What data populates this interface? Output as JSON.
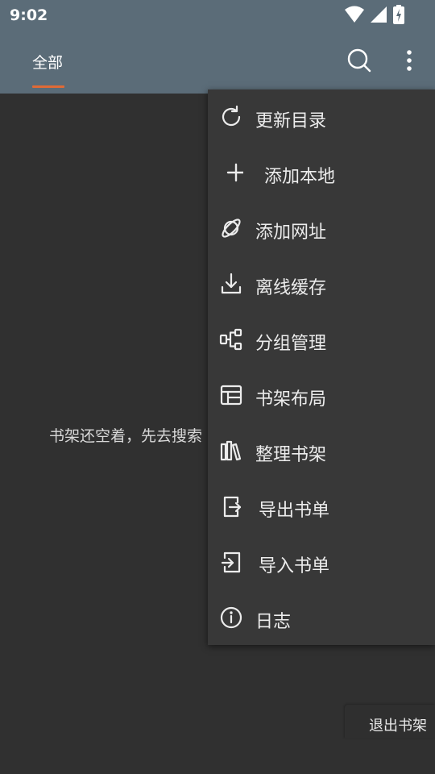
{
  "status_bar": {
    "time": "9:02",
    "icons": [
      "wifi-icon",
      "cell-signal-icon",
      "battery-charging-icon"
    ]
  },
  "app_bar": {
    "tabs": [
      {
        "label": "全部",
        "selected": true
      }
    ],
    "actions": [
      "search-icon",
      "more-vert-icon"
    ]
  },
  "colors": {
    "app_bar": "#5b6c78",
    "background": "#303030",
    "menu_background": "#383838",
    "tab_indicator": "#e06a36"
  },
  "main": {
    "empty_message": "书架还空着，先去搜索"
  },
  "overflow_menu": {
    "items": [
      {
        "label": "更新目录",
        "icon": "refresh-icon"
      },
      {
        "label": "添加本地",
        "icon": "plus-icon"
      },
      {
        "label": "添加网址",
        "icon": "planet-icon"
      },
      {
        "label": "离线缓存",
        "icon": "download-icon"
      },
      {
        "label": "分组管理",
        "icon": "group-tree-icon"
      },
      {
        "label": "书架布局",
        "icon": "layout-icon"
      },
      {
        "label": "整理书架",
        "icon": "books-icon"
      },
      {
        "label": "导出书单",
        "icon": "export-icon"
      },
      {
        "label": "导入书单",
        "icon": "import-icon"
      },
      {
        "label": "日志",
        "icon": "info-icon"
      }
    ]
  },
  "bottom_action": {
    "label": "退出书架"
  }
}
